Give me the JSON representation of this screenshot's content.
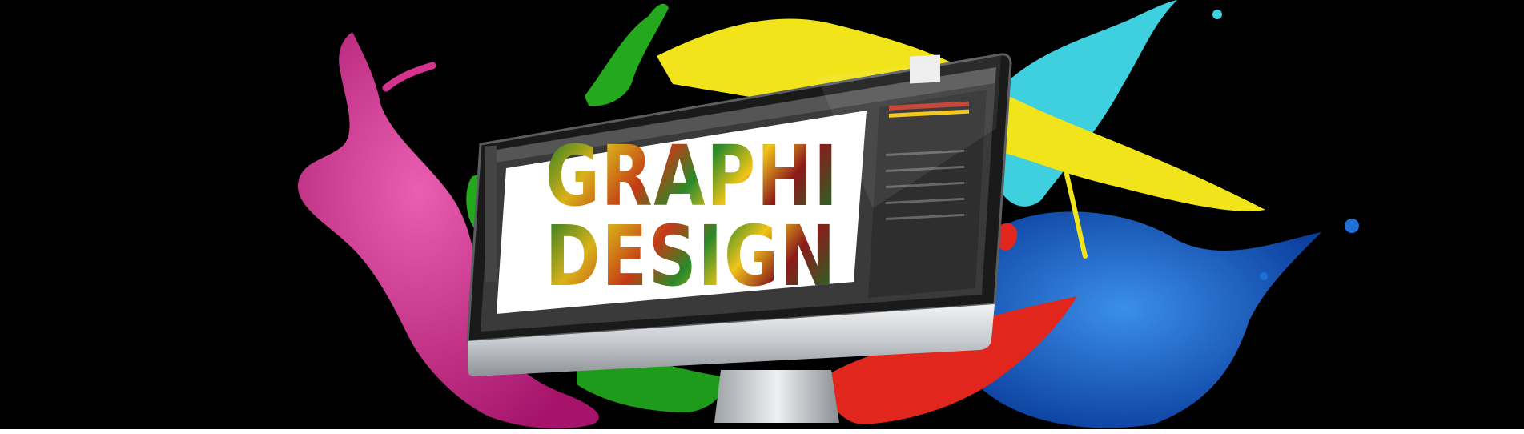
{
  "headline": {
    "line1": "GRAPHIC",
    "line2": "DESIGN"
  },
  "colors": {
    "background": "#000000",
    "magenta_splash": "#d6338f",
    "green_splash": "#23a81e",
    "yellow_splash": "#f1e41b",
    "cyan_splash": "#3fd0df",
    "blue_splash": "#1f6fd6",
    "red_splash": "#e0261d",
    "monitor_silver": "#d8dadd",
    "screen_ui_dark": "#3a3a3a"
  },
  "icons": [
    "paint-splash",
    "monitor",
    "design-app-window"
  ]
}
